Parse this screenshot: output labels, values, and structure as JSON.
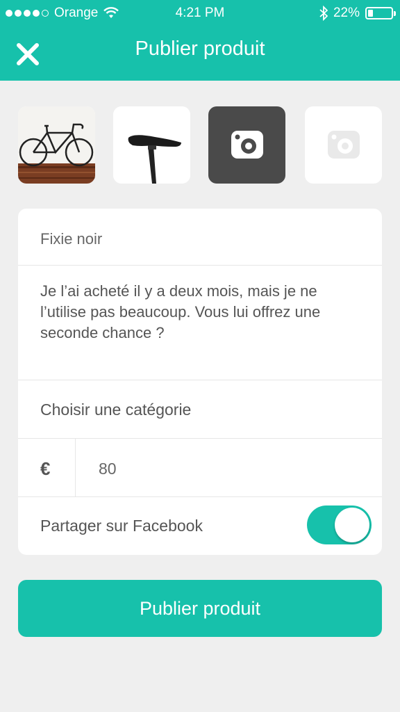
{
  "status_bar": {
    "carrier": "Orange",
    "time": "4:21 PM",
    "battery": "22%",
    "battery_level": 0.22
  },
  "header": {
    "title": "Publier produit",
    "close_icon": "close-icon"
  },
  "photos": [
    {
      "name": "photo-bicycle",
      "icon": "bicycle-photo"
    },
    {
      "name": "photo-saddle",
      "icon": "saddle-photo"
    },
    {
      "name": "add-photo-button-active",
      "icon": "camera-icon"
    },
    {
      "name": "add-photo-button",
      "icon": "camera-icon"
    }
  ],
  "form": {
    "title_value": "Fixie noir",
    "description_value": "Je l’ai acheté il y a deux mois, mais je ne l’utilise pas beaucoup. Vous lui offrez une seconde chance ?",
    "category_placeholder": "Choisir une catégorie",
    "currency_symbol": "€",
    "price_value": "80",
    "facebook_label": "Partager sur Facebook",
    "facebook_toggle_on": true
  },
  "publish_button": {
    "label": "Publier produit"
  },
  "colors": {
    "accent": "#17c1ab",
    "background": "#efefef",
    "dark_tile": "#4a4a4a"
  }
}
